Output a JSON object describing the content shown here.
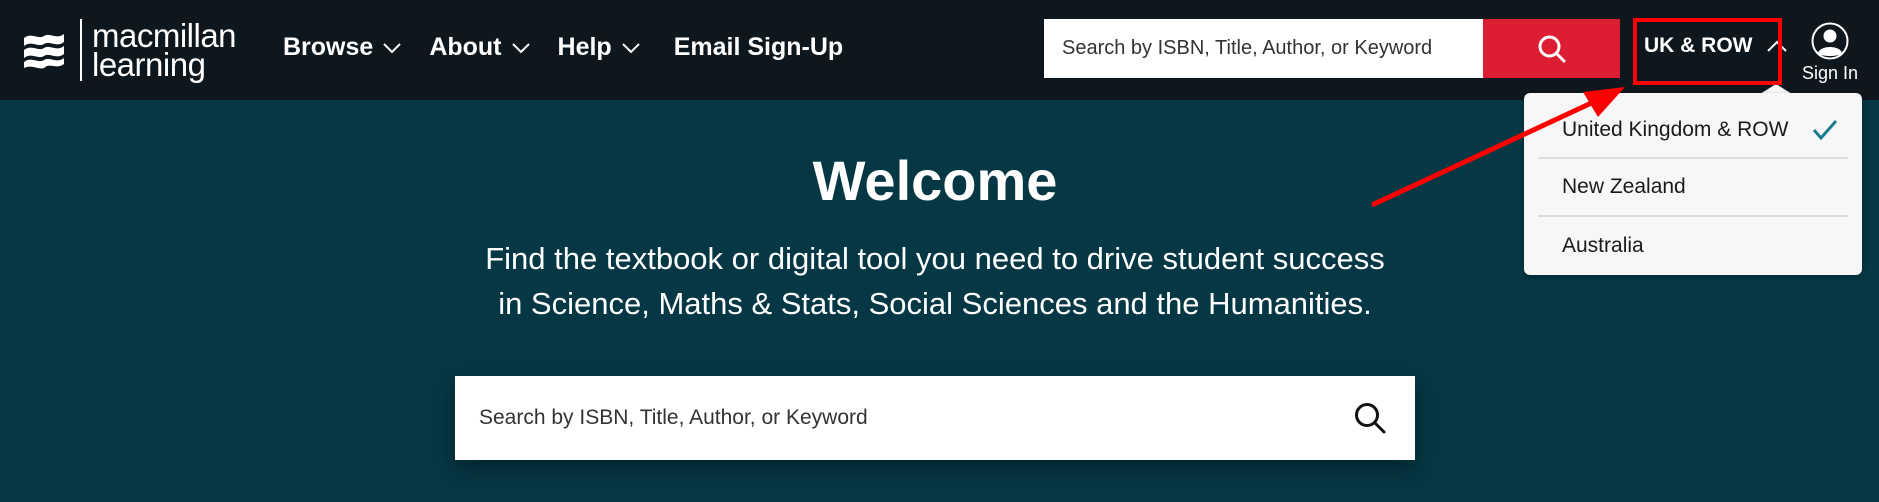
{
  "header": {
    "logo": {
      "line1": "macmillan",
      "line2": "learning"
    },
    "nav": [
      {
        "label": "Browse",
        "has_dropdown": true
      },
      {
        "label": "About",
        "has_dropdown": true
      },
      {
        "label": "Help",
        "has_dropdown": true
      },
      {
        "label": "Email Sign-Up",
        "has_dropdown": false
      }
    ],
    "search": {
      "placeholder": "Search by ISBN, Title, Author, or Keyword",
      "value": "",
      "button_icon": "search-icon"
    },
    "region_selector": {
      "label": "UK & ROW",
      "state": "expanded",
      "icon": "chevron-up-icon"
    },
    "sign_in": {
      "label": "Sign In",
      "icon": "user-circle-icon"
    }
  },
  "region_dropdown": {
    "items": [
      {
        "label": "United Kingdom & ROW",
        "selected": true
      },
      {
        "label": "New Zealand",
        "selected": false
      },
      {
        "label": "Australia",
        "selected": false
      }
    ]
  },
  "hero": {
    "title": "Welcome",
    "subtitle_line1": "Find the textbook or digital tool you need to drive student success",
    "subtitle_line2": "in Science, Maths & Stats, Social Sciences and the Humanities.",
    "search": {
      "placeholder": "Search by ISBN, Title, Author, or Keyword",
      "value": "",
      "icon": "search-icon"
    }
  },
  "annotation": {
    "type": "red-arrow-and-box",
    "target": "region-selector",
    "color": "#ff0000"
  },
  "colors": {
    "header_bg": "#0e171e",
    "hero_bg": "#053744",
    "accent_red": "#dc1e32",
    "check_teal": "#1e7d8c",
    "dropdown_bg": "#f7f7f7"
  }
}
